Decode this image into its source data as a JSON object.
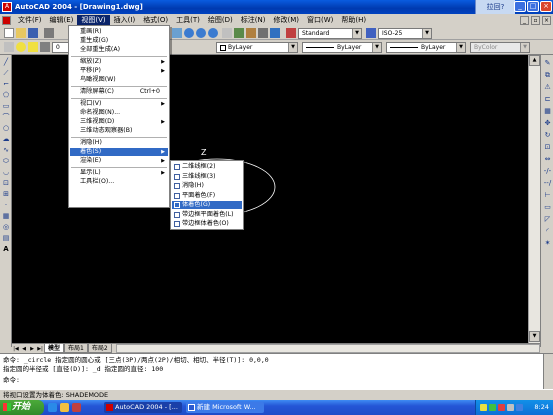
{
  "window": {
    "title": "AutoCAD 2004 - [Drawing1.dwg]",
    "restore_tag": "拉回?",
    "min_label": "_",
    "max_label": "□",
    "close_label": "×"
  },
  "menubar": {
    "items": [
      "文件(F)",
      "编辑(E)",
      "视图(V)",
      "插入(I)",
      "格式(O)",
      "工具(T)",
      "绘图(D)",
      "标注(N)",
      "修改(M)",
      "窗口(W)",
      "帮助(H)"
    ],
    "active_index": 2
  },
  "toolbar": {
    "text_style": "Standard",
    "dim_style": "ISO-25",
    "color": "ByLayer",
    "linetype": "ByLayer",
    "lineweight": "ByLayer",
    "plot_style": "ByColor",
    "layer_name": "0"
  },
  "view_menu": {
    "items": [
      {
        "label": "重画(R)",
        "shortcut": "",
        "submenu": false
      },
      {
        "label": "重生成(G)",
        "shortcut": "",
        "submenu": false
      },
      {
        "label": "全部重生成(A)",
        "shortcut": "",
        "submenu": false
      },
      {
        "sep": true
      },
      {
        "label": "缩放(Z)",
        "shortcut": "",
        "submenu": true
      },
      {
        "label": "平移(P)",
        "shortcut": "",
        "submenu": true
      },
      {
        "label": "鸟瞰视图(W)",
        "shortcut": "",
        "submenu": false
      },
      {
        "sep": true
      },
      {
        "label": "清除屏幕(C)",
        "shortcut": "Ctrl+0",
        "submenu": false
      },
      {
        "sep": true
      },
      {
        "label": "视口(V)",
        "shortcut": "",
        "submenu": true
      },
      {
        "label": "命名视图(N)...",
        "shortcut": "",
        "submenu": false
      },
      {
        "label": "三维视图(D)",
        "shortcut": "",
        "submenu": true
      },
      {
        "label": "三维动态观察器(B)",
        "shortcut": "",
        "submenu": false
      },
      {
        "sep": true
      },
      {
        "label": "消隐(H)",
        "shortcut": "",
        "submenu": false
      },
      {
        "label": "着色(S)",
        "shortcut": "",
        "submenu": true,
        "highlight": true
      },
      {
        "label": "渲染(E)",
        "shortcut": "",
        "submenu": true
      },
      {
        "sep": true
      },
      {
        "label": "显示(L)",
        "shortcut": "",
        "submenu": true
      },
      {
        "label": "工具栏(O)...",
        "shortcut": "",
        "submenu": false
      }
    ]
  },
  "shade_menu": {
    "items": [
      {
        "label": "二维线框(2)"
      },
      {
        "label": "三维线框(3)"
      },
      {
        "label": "消隐(H)"
      },
      {
        "label": "平面着色(F)"
      },
      {
        "label": "体着色(G)",
        "highlight": true
      },
      {
        "label": "带边框平面着色(L)"
      },
      {
        "label": "带边框体着色(O)"
      }
    ]
  },
  "canvas": {
    "ucs_z_label": "Z"
  },
  "layout_tabs": {
    "items": [
      "模型",
      "布局1",
      "布局2"
    ],
    "active_index": 0,
    "nav": [
      "|◀",
      "◀",
      "▶",
      "▶|"
    ]
  },
  "command": {
    "lines": [
      "命令: _circle 指定圆的圆心或 [三点(3P)/两点(2P)/相切、相切、半径(T)]: 0,0,0",
      "指定圆的半径或 [直径(D)]: _d 指定圆的直径: 100",
      "命令:"
    ]
  },
  "status": {
    "text": "将视口设置为体着色:  SHADEMODE"
  },
  "taskbar": {
    "start_label": "开始",
    "items": [
      {
        "label": "AutoCAD 2004 - [..."
      },
      {
        "label": "新建 Microsoft W..."
      }
    ],
    "clock": "8:24"
  }
}
